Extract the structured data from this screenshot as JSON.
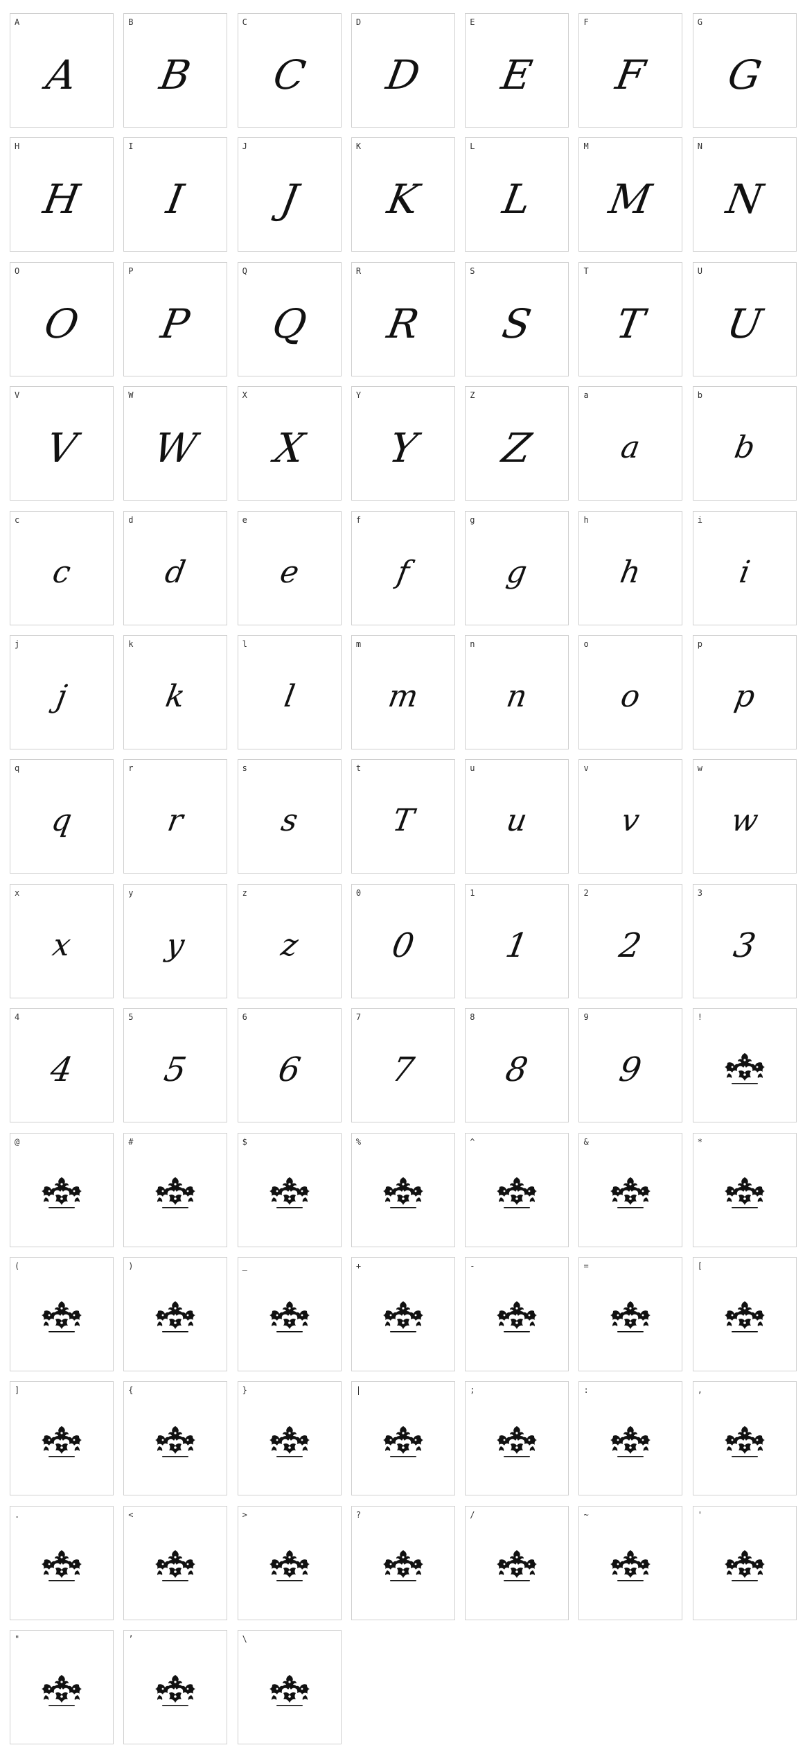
{
  "colors": {
    "background": "#ffffff",
    "cell_border": "#cfcfcf",
    "label_text": "#333333",
    "glyph": "#111111"
  },
  "cells": [
    {
      "label": "A",
      "glyph": "A",
      "kind": "upper"
    },
    {
      "label": "B",
      "glyph": "B",
      "kind": "upper"
    },
    {
      "label": "C",
      "glyph": "C",
      "kind": "upper"
    },
    {
      "label": "D",
      "glyph": "D",
      "kind": "upper"
    },
    {
      "label": "E",
      "glyph": "E",
      "kind": "upper"
    },
    {
      "label": "F",
      "glyph": "F",
      "kind": "upper"
    },
    {
      "label": "G",
      "glyph": "G",
      "kind": "upper"
    },
    {
      "label": "H",
      "glyph": "H",
      "kind": "upper"
    },
    {
      "label": "I",
      "glyph": "I",
      "kind": "upper"
    },
    {
      "label": "J",
      "glyph": "J",
      "kind": "upper"
    },
    {
      "label": "K",
      "glyph": "K",
      "kind": "upper"
    },
    {
      "label": "L",
      "glyph": "L",
      "kind": "upper"
    },
    {
      "label": "M",
      "glyph": "M",
      "kind": "upper"
    },
    {
      "label": "N",
      "glyph": "N",
      "kind": "upper"
    },
    {
      "label": "O",
      "glyph": "O",
      "kind": "upper"
    },
    {
      "label": "P",
      "glyph": "P",
      "kind": "upper"
    },
    {
      "label": "Q",
      "glyph": "Q",
      "kind": "upper"
    },
    {
      "label": "R",
      "glyph": "R",
      "kind": "upper"
    },
    {
      "label": "S",
      "glyph": "S",
      "kind": "upper"
    },
    {
      "label": "T",
      "glyph": "T",
      "kind": "upper"
    },
    {
      "label": "U",
      "glyph": "U",
      "kind": "upper"
    },
    {
      "label": "V",
      "glyph": "V",
      "kind": "upper"
    },
    {
      "label": "W",
      "glyph": "W",
      "kind": "upper"
    },
    {
      "label": "X",
      "glyph": "X",
      "kind": "upper"
    },
    {
      "label": "Y",
      "glyph": "Y",
      "kind": "upper"
    },
    {
      "label": "Z",
      "glyph": "Z",
      "kind": "upper"
    },
    {
      "label": "a",
      "glyph": "a",
      "kind": "lower"
    },
    {
      "label": "b",
      "glyph": "b",
      "kind": "lower"
    },
    {
      "label": "c",
      "glyph": "c",
      "kind": "lower"
    },
    {
      "label": "d",
      "glyph": "d",
      "kind": "lower"
    },
    {
      "label": "e",
      "glyph": "e",
      "kind": "lower"
    },
    {
      "label": "f",
      "glyph": "f",
      "kind": "lower"
    },
    {
      "label": "g",
      "glyph": "g",
      "kind": "lower"
    },
    {
      "label": "h",
      "glyph": "h",
      "kind": "lower"
    },
    {
      "label": "i",
      "glyph": "i",
      "kind": "lower"
    },
    {
      "label": "j",
      "glyph": "j",
      "kind": "lower"
    },
    {
      "label": "k",
      "glyph": "k",
      "kind": "lower"
    },
    {
      "label": "l",
      "glyph": "l",
      "kind": "lower"
    },
    {
      "label": "m",
      "glyph": "m",
      "kind": "lower"
    },
    {
      "label": "n",
      "glyph": "n",
      "kind": "lower"
    },
    {
      "label": "o",
      "glyph": "o",
      "kind": "lower"
    },
    {
      "label": "p",
      "glyph": "p",
      "kind": "lower"
    },
    {
      "label": "q",
      "glyph": "q",
      "kind": "lower"
    },
    {
      "label": "r",
      "glyph": "r",
      "kind": "lower"
    },
    {
      "label": "s",
      "glyph": "s",
      "kind": "lower"
    },
    {
      "label": "t",
      "glyph": "T",
      "kind": "lower"
    },
    {
      "label": "u",
      "glyph": "u",
      "kind": "lower"
    },
    {
      "label": "v",
      "glyph": "v",
      "kind": "lower"
    },
    {
      "label": "w",
      "glyph": "w",
      "kind": "lower"
    },
    {
      "label": "x",
      "glyph": "x",
      "kind": "lower"
    },
    {
      "label": "y",
      "glyph": "y",
      "kind": "lower"
    },
    {
      "label": "z",
      "glyph": "z",
      "kind": "lower"
    },
    {
      "label": "0",
      "glyph": "0",
      "kind": "digit"
    },
    {
      "label": "1",
      "glyph": "1",
      "kind": "digit"
    },
    {
      "label": "2",
      "glyph": "2",
      "kind": "digit"
    },
    {
      "label": "3",
      "glyph": "3",
      "kind": "digit"
    },
    {
      "label": "4",
      "glyph": "4",
      "kind": "digit"
    },
    {
      "label": "5",
      "glyph": "5",
      "kind": "digit"
    },
    {
      "label": "6",
      "glyph": "6",
      "kind": "digit"
    },
    {
      "label": "7",
      "glyph": "7",
      "kind": "digit"
    },
    {
      "label": "8",
      "glyph": "8",
      "kind": "digit"
    },
    {
      "label": "9",
      "glyph": "9",
      "kind": "digit"
    },
    {
      "label": "!",
      "kind": "ornament"
    },
    {
      "label": "@",
      "kind": "ornament"
    },
    {
      "label": "#",
      "kind": "ornament"
    },
    {
      "label": "$",
      "kind": "ornament"
    },
    {
      "label": "%",
      "kind": "ornament"
    },
    {
      "label": "^",
      "kind": "ornament"
    },
    {
      "label": "&",
      "kind": "ornament"
    },
    {
      "label": "*",
      "kind": "ornament"
    },
    {
      "label": "(",
      "kind": "ornament"
    },
    {
      "label": ")",
      "kind": "ornament"
    },
    {
      "label": "_",
      "kind": "ornament"
    },
    {
      "label": "+",
      "kind": "ornament"
    },
    {
      "label": "-",
      "kind": "ornament"
    },
    {
      "label": "=",
      "kind": "ornament"
    },
    {
      "label": "[",
      "kind": "ornament"
    },
    {
      "label": "]",
      "kind": "ornament"
    },
    {
      "label": "{",
      "kind": "ornament"
    },
    {
      "label": "}",
      "kind": "ornament"
    },
    {
      "label": "|",
      "kind": "ornament"
    },
    {
      "label": ";",
      "kind": "ornament"
    },
    {
      "label": ":",
      "kind": "ornament"
    },
    {
      "label": ",",
      "kind": "ornament"
    },
    {
      "label": ".",
      "kind": "ornament"
    },
    {
      "label": "<",
      "kind": "ornament"
    },
    {
      "label": ">",
      "kind": "ornament"
    },
    {
      "label": "?",
      "kind": "ornament"
    },
    {
      "label": "/",
      "kind": "ornament"
    },
    {
      "label": "~",
      "kind": "ornament"
    },
    {
      "label": "'",
      "kind": "ornament"
    },
    {
      "label": "\"",
      "kind": "ornament"
    },
    {
      "label": "’",
      "kind": "ornament"
    },
    {
      "label": "\\",
      "kind": "ornament"
    }
  ],
  "ornament_icon": "damask-ornament-icon"
}
